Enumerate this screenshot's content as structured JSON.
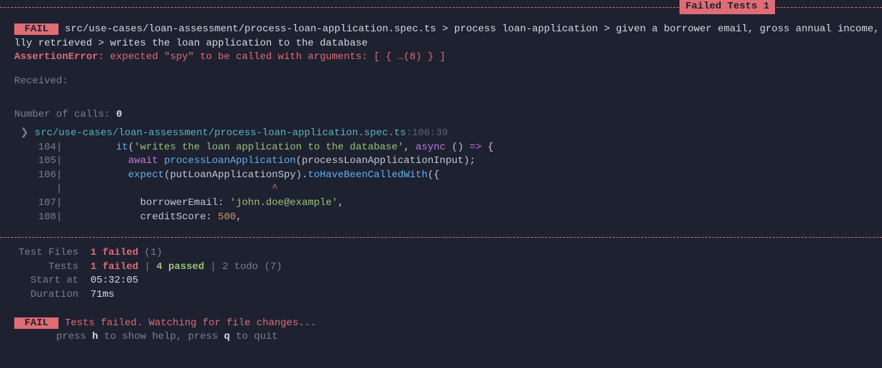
{
  "header": {
    "failedTestsLabel": " Failed Tests 1 "
  },
  "fail": {
    "badge": " FAIL ",
    "pathLine1": " src/use-cases/loan-assessment/process-loan-application.spec.ts > process loan-application > given a borrower email, gross annual income, employme",
    "pathLine2": "lly retrieved > writes the loan application to the database",
    "assertionLabel": "AssertionError",
    "assertionMsg": ": expected \"spy\" to be called with arguments: [ { …(8) } ]",
    "receivedLabel": "Received:",
    "callsLabel": "Number of calls: ",
    "callsCount": "0"
  },
  "trace": {
    "caret": " ❯ ",
    "file": "src/use-cases/loan-assessment/process-loan-application.spec.ts",
    "loc": ":106:39"
  },
  "code": {
    "l104": {
      "num": "    104",
      "pipe": "|         ",
      "it": "it",
      "paren1": "(",
      "str": "'writes the loan application to the database'",
      "comma": ", ",
      "async": "async",
      "rest": " () ",
      "arrow": "=>",
      "brace": " {"
    },
    "l105": {
      "num": "    105",
      "pipe": "|           ",
      "await": "await",
      "space": " ",
      "fn": "processLoanApplication",
      "paren": "(processLoanApplicationInput);"
    },
    "l106": {
      "num": "    106",
      "pipe": "|           ",
      "expect": "expect",
      "mid": "(putLoanApplicationSpy).",
      "matcher": "toHaveBeenCalledWith",
      "end": "({"
    },
    "caret": {
      "pad": "       |                                   ",
      "mark": "^"
    },
    "l107": {
      "num": "    107",
      "pipe": "|             ",
      "key": "borrowerEmail",
      "colon": ": ",
      "val": "'john.doe@example'",
      "comma": ","
    },
    "l108": {
      "num": "    108",
      "pipe": "|             ",
      "key": "creditScore",
      "colon": ": ",
      "val": "500",
      "comma": ","
    }
  },
  "summary": {
    "testFilesLabel": "Test Files",
    "testFilesValue1": "1 failed",
    "testFilesValue2": " (1)",
    "testsLabel": "Tests",
    "testsFailed": "1 failed",
    "testsSep1": " | ",
    "testsPassed": "4 passed",
    "testsRest": " | 2 todo (7)",
    "startLabel": "Start at",
    "startValue": "05:32:05",
    "durationLabel": "Duration",
    "durationValue": "71ms"
  },
  "footer": {
    "badge": " FAIL ",
    "msg": " Tests failed. Watching for file changes...",
    "hintPre": "       press ",
    "keyH": "h",
    "hintMid": " to show help, press ",
    "keyQ": "q",
    "hintEnd": " to quit"
  }
}
